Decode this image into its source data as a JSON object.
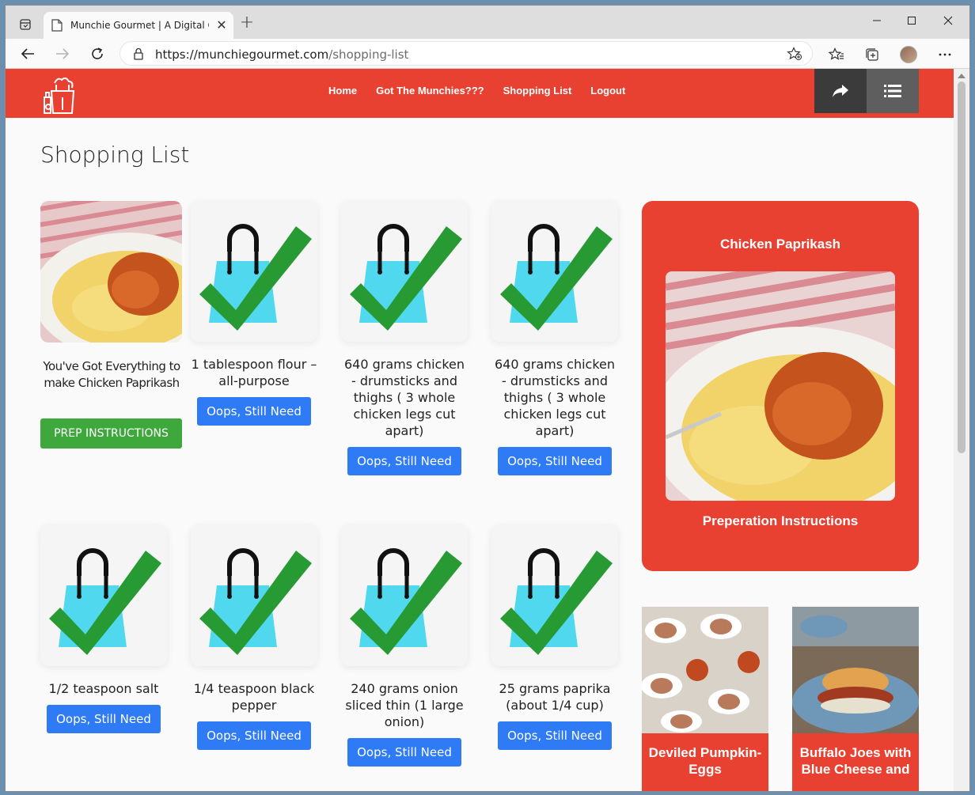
{
  "browser": {
    "tab_title": "Munchie Gourmet | A Digital Cra",
    "url_host": "https://munchiegourmet.com",
    "url_path": "/shopping-list"
  },
  "site": {
    "nav": [
      "Home",
      "Got The Munchies???",
      "Shopping List",
      "Logout"
    ],
    "brand_color": "#e94131"
  },
  "page": {
    "title": "Shopping List",
    "summary_card": {
      "label": "You've Got Everything to make Chicken Paprikash",
      "button": "PREP INSTRUCTIONS"
    },
    "items": [
      {
        "label": "1 tablespoon flour – all-purpose",
        "button": "Oops, Still Need"
      },
      {
        "label": "640 grams chicken - drumsticks and thighs ( 3 whole chicken legs cut apart)",
        "button": "Oops, Still Need"
      },
      {
        "label": "640 grams chicken - drumsticks and thighs ( 3 whole chicken legs cut apart)",
        "button": "Oops, Still Need"
      },
      {
        "label": "1/2 teaspoon salt",
        "button": "Oops, Still Need"
      },
      {
        "label": "1/4 teaspoon black pepper",
        "button": "Oops, Still Need"
      },
      {
        "label": "240 grams onion sliced thin (1 large onion)",
        "button": "Oops, Still Need"
      },
      {
        "label": "25 grams paprika (about 1/4 cup)",
        "button": "Oops, Still Need"
      }
    ]
  },
  "sidebar": {
    "recipe_title": "Chicken Paprikash",
    "prep_link": "Preperation Instructions",
    "recommendations": [
      {
        "title": "Deviled Pumpkin-Eggs"
      },
      {
        "title": "Buffalo Joes with Blue Cheese and"
      }
    ]
  }
}
